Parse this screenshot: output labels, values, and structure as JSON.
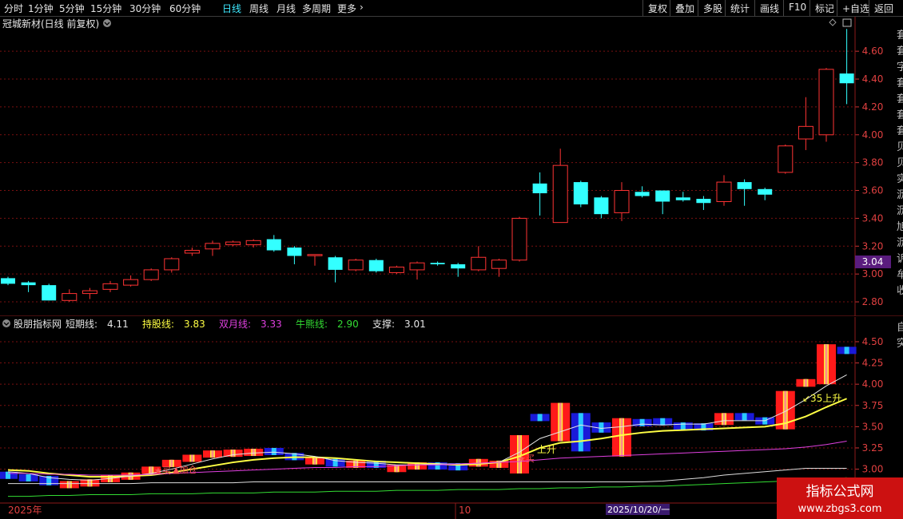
{
  "toolbar": {
    "periods": [
      "分时",
      "1分钟",
      "5分钟",
      "15分钟",
      "30分钟",
      "60分钟",
      "日线",
      "周线",
      "月线",
      "多周期",
      "更多"
    ],
    "active_period": "日线",
    "right_buttons": [
      "复权",
      "叠加",
      "多股",
      "统计",
      "画线",
      "F10",
      "标记",
      "+自选",
      "返回"
    ]
  },
  "main_panel": {
    "stock_title": "冠城新材(日线 前复权)",
    "price_axis_ticks": [
      "4.60",
      "4.40",
      "4.20",
      "4.00",
      "3.80",
      "3.60",
      "3.40",
      "3.20",
      "3.00",
      "2.80"
    ],
    "current_price_tag": "3.04",
    "right_edge_text": "套套字套套套套贝贝实沥沥旭沥诉牟收"
  },
  "sub_panel": {
    "indicator_name": "股朋指标网",
    "legend": [
      {
        "label": "短期线:",
        "value": "4.11",
        "color": "#e6e6e6"
      },
      {
        "label": "持股线:",
        "value": "3.83",
        "color": "#ffff44"
      },
      {
        "label": "双月线:",
        "value": "3.33",
        "color": "#e040e0"
      },
      {
        "label": "牛熊线:",
        "value": "2.90",
        "color": "#33dd33"
      },
      {
        "label": "支撑:",
        "value": "3.01",
        "color": "#e6e6e6"
      }
    ],
    "axis_ticks": [
      "4.50",
      "4.25",
      "4.00",
      "3.75",
      "3.50",
      "3.25",
      "3.00"
    ],
    "annotations": [
      "买",
      "加仓",
      "上升",
      "买",
      "↙35上升"
    ],
    "right_edge_text": "自突"
  },
  "date_axis": {
    "labels": [
      "2025年",
      "10",
      "2025/10/20/一"
    ]
  },
  "watermark": {
    "title": "指标公式网",
    "url": "www.zbgs3.com"
  },
  "colors": {
    "up": "#ff3333",
    "down": "#33ffff",
    "grid": "#7a1010",
    "axis": "#8b1a1a"
  },
  "chart_data": {
    "type": "candlestick",
    "y_range": [
      2.72,
      4.75
    ],
    "candles": [
      {
        "o": 2.97,
        "c": 2.93,
        "h": 2.98,
        "l": 2.92,
        "d": true
      },
      {
        "o": 2.94,
        "c": 2.92,
        "h": 2.95,
        "l": 2.87,
        "d": true
      },
      {
        "o": 2.92,
        "c": 2.81,
        "h": 2.93,
        "l": 2.81,
        "d": true
      },
      {
        "o": 2.81,
        "c": 2.86,
        "h": 2.89,
        "l": 2.8,
        "d": false
      },
      {
        "o": 2.86,
        "c": 2.88,
        "h": 2.9,
        "l": 2.82,
        "d": false
      },
      {
        "o": 2.89,
        "c": 2.93,
        "h": 2.95,
        "l": 2.87,
        "d": false
      },
      {
        "o": 2.92,
        "c": 2.96,
        "h": 2.99,
        "l": 2.91,
        "d": false
      },
      {
        "o": 2.96,
        "c": 3.03,
        "h": 3.04,
        "l": 2.95,
        "d": false
      },
      {
        "o": 3.03,
        "c": 3.11,
        "h": 3.12,
        "l": 3.01,
        "d": false
      },
      {
        "o": 3.15,
        "c": 3.17,
        "h": 3.19,
        "l": 3.13,
        "d": false
      },
      {
        "o": 3.18,
        "c": 3.22,
        "h": 3.24,
        "l": 3.13,
        "d": false
      },
      {
        "o": 3.21,
        "c": 3.23,
        "h": 3.24,
        "l": 3.2,
        "d": false
      },
      {
        "o": 3.21,
        "c": 3.24,
        "h": 3.25,
        "l": 3.19,
        "d": false
      },
      {
        "o": 3.25,
        "c": 3.17,
        "h": 3.28,
        "l": 3.16,
        "d": true
      },
      {
        "o": 3.19,
        "c": 3.13,
        "h": 3.2,
        "l": 3.07,
        "d": true
      },
      {
        "o": 3.14,
        "c": 3.14,
        "h": 3.14,
        "l": 3.06,
        "d": false
      },
      {
        "o": 3.12,
        "c": 3.03,
        "h": 3.13,
        "l": 2.94,
        "d": true
      },
      {
        "o": 3.03,
        "c": 3.1,
        "h": 3.11,
        "l": 3.02,
        "d": false
      },
      {
        "o": 3.1,
        "c": 3.02,
        "h": 3.11,
        "l": 3.01,
        "d": true
      },
      {
        "o": 3.01,
        "c": 3.05,
        "h": 3.06,
        "l": 3.0,
        "d": false
      },
      {
        "o": 3.03,
        "c": 3.08,
        "h": 3.09,
        "l": 2.96,
        "d": false
      },
      {
        "o": 3.08,
        "c": 3.07,
        "h": 3.09,
        "l": 3.06,
        "d": true
      },
      {
        "o": 3.07,
        "c": 3.04,
        "h": 3.08,
        "l": 2.98,
        "d": true
      },
      {
        "o": 3.03,
        "c": 3.12,
        "h": 3.2,
        "l": 3.02,
        "d": false
      },
      {
        "o": 3.04,
        "c": 3.1,
        "h": 3.11,
        "l": 2.98,
        "d": false
      },
      {
        "o": 3.1,
        "c": 3.4,
        "h": 3.41,
        "l": 3.09,
        "d": false
      },
      {
        "o": 3.65,
        "c": 3.58,
        "h": 3.73,
        "l": 3.42,
        "d": true
      },
      {
        "o": 3.37,
        "c": 3.78,
        "h": 3.9,
        "l": 3.37,
        "d": false
      },
      {
        "o": 3.66,
        "c": 3.5,
        "h": 3.67,
        "l": 3.48,
        "d": true
      },
      {
        "o": 3.55,
        "c": 3.43,
        "h": 3.56,
        "l": 3.4,
        "d": true
      },
      {
        "o": 3.44,
        "c": 3.6,
        "h": 3.66,
        "l": 3.38,
        "d": false
      },
      {
        "o": 3.59,
        "c": 3.56,
        "h": 3.63,
        "l": 3.55,
        "d": true
      },
      {
        "o": 3.6,
        "c": 3.52,
        "h": 3.6,
        "l": 3.43,
        "d": true
      },
      {
        "o": 3.55,
        "c": 3.53,
        "h": 3.59,
        "l": 3.52,
        "d": true
      },
      {
        "o": 3.54,
        "c": 3.51,
        "h": 3.56,
        "l": 3.46,
        "d": true
      },
      {
        "o": 3.52,
        "c": 3.66,
        "h": 3.71,
        "l": 3.49,
        "d": false
      },
      {
        "o": 3.66,
        "c": 3.61,
        "h": 3.68,
        "l": 3.49,
        "d": true
      },
      {
        "o": 3.61,
        "c": 3.57,
        "h": 3.62,
        "l": 3.53,
        "d": true
      },
      {
        "o": 3.73,
        "c": 3.92,
        "h": 3.93,
        "l": 3.72,
        "d": false
      },
      {
        "o": 3.97,
        "c": 4.06,
        "h": 4.27,
        "l": 3.89,
        "d": false
      },
      {
        "o": 4.0,
        "c": 4.47,
        "h": 4.48,
        "l": 3.95,
        "d": false
      },
      {
        "o": 4.44,
        "c": 4.37,
        "h": 4.76,
        "l": 4.22,
        "d": true
      }
    ],
    "sub_y_range": [
      2.62,
      4.65
    ],
    "indicator_lines": [
      {
        "name": "持股线",
        "color": "#ffff44",
        "values": [
          2.99,
          2.98,
          2.95,
          2.93,
          2.91,
          2.91,
          2.92,
          2.93,
          2.96,
          3.0,
          3.04,
          3.08,
          3.11,
          3.13,
          3.14,
          3.14,
          3.13,
          3.11,
          3.09,
          3.08,
          3.07,
          3.06,
          3.05,
          3.06,
          3.08,
          3.15,
          3.25,
          3.31,
          3.33,
          3.36,
          3.4,
          3.43,
          3.45,
          3.46,
          3.47,
          3.48,
          3.49,
          3.5,
          3.54,
          3.62,
          3.73,
          3.83
        ]
      },
      {
        "name": "短期线",
        "color": "#e6e6e6",
        "values": [
          2.97,
          2.95,
          2.9,
          2.88,
          2.87,
          2.89,
          2.92,
          2.95,
          3.0,
          3.06,
          3.12,
          3.17,
          3.19,
          3.2,
          3.18,
          3.15,
          3.1,
          3.08,
          3.07,
          3.05,
          3.05,
          3.06,
          3.06,
          3.07,
          3.08,
          3.2,
          3.36,
          3.44,
          3.52,
          3.48,
          3.5,
          3.53,
          3.52,
          3.53,
          3.53,
          3.57,
          3.57,
          3.57,
          3.68,
          3.82,
          3.98,
          4.11
        ]
      },
      {
        "name": "双月线",
        "color": "#e040e0",
        "values": [
          2.95,
          2.95,
          2.94,
          2.94,
          2.93,
          2.93,
          2.93,
          2.94,
          2.95,
          2.96,
          2.97,
          2.98,
          2.99,
          3.0,
          3.01,
          3.02,
          3.02,
          3.03,
          3.03,
          3.04,
          3.05,
          3.05,
          3.06,
          3.07,
          3.08,
          3.09,
          3.11,
          3.13,
          3.14,
          3.15,
          3.16,
          3.17,
          3.18,
          3.19,
          3.2,
          3.21,
          3.22,
          3.23,
          3.24,
          3.26,
          3.29,
          3.33
        ]
      },
      {
        "name": "支撑",
        "color": "#dddddd",
        "values": [
          2.83,
          2.83,
          2.83,
          2.83,
          2.83,
          2.83,
          2.83,
          2.84,
          2.84,
          2.84,
          2.84,
          2.84,
          2.85,
          2.85,
          2.85,
          2.85,
          2.85,
          2.85,
          2.85,
          2.85,
          2.85,
          2.85,
          2.85,
          2.85,
          2.85,
          2.85,
          2.85,
          2.85,
          2.85,
          2.85,
          2.85,
          2.85,
          2.86,
          2.88,
          2.9,
          2.93,
          2.95,
          2.97,
          2.99,
          3.01,
          3.01,
          3.01
        ]
      },
      {
        "name": "牛熊线",
        "color": "#33dd33",
        "values": [
          2.68,
          2.68,
          2.69,
          2.69,
          2.7,
          2.7,
          2.7,
          2.71,
          2.71,
          2.71,
          2.72,
          2.72,
          2.72,
          2.73,
          2.73,
          2.73,
          2.74,
          2.74,
          2.74,
          2.75,
          2.75,
          2.75,
          2.76,
          2.76,
          2.76,
          2.77,
          2.77,
          2.78,
          2.78,
          2.79,
          2.79,
          2.8,
          2.8,
          2.81,
          2.82,
          2.83,
          2.84,
          2.85,
          2.86,
          2.87,
          2.88,
          2.9
        ]
      }
    ]
  }
}
